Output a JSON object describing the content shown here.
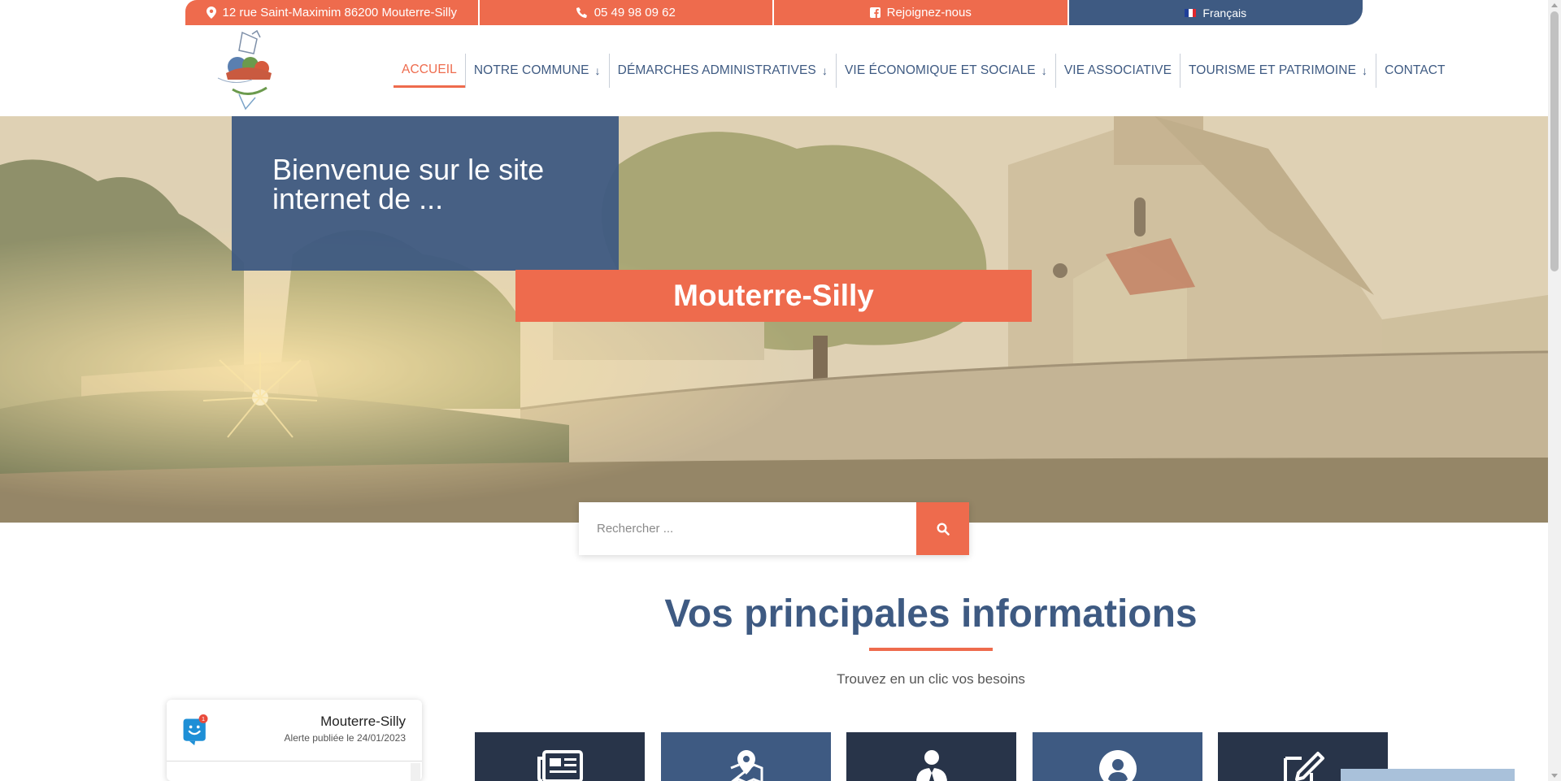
{
  "topbar": {
    "address": "12 rue Saint-Maximim 86200 Mouterre-Silly",
    "phone": "05 49 98 09 62",
    "social": "Rejoignez-nous",
    "language": "Français"
  },
  "logo": {
    "text": "Mouterre-Silly"
  },
  "nav": {
    "items": [
      {
        "label": "ACCUEIL"
      },
      {
        "label": "NOTRE COMMUNE"
      },
      {
        "label": "DÉMARCHES ADMINISTRATIVES"
      },
      {
        "label": "VIE ÉCONOMIQUE ET SOCIALE"
      },
      {
        "label": "VIE ASSOCIATIVE"
      },
      {
        "label": "TOURISME ET PATRIMOINE"
      },
      {
        "label": "CONTACT"
      }
    ]
  },
  "hero": {
    "welcome": "Bienvenue sur le site internet de ...",
    "town": "Mouterre-Silly"
  },
  "search": {
    "placeholder": "Rechercher ..."
  },
  "section": {
    "title": "Vos principales informations",
    "subtitle": "Trouvez en un clic vos besoins"
  },
  "tiles": [
    {
      "icon": "newspaper-icon"
    },
    {
      "icon": "map-pin-icon"
    },
    {
      "icon": "person-tie-icon"
    },
    {
      "icon": "user-circle-icon"
    },
    {
      "icon": "edit-icon"
    }
  ],
  "alert": {
    "title": "Mouterre-Silly",
    "date": "Alerte publiée le 24/01/2023",
    "badge": "1"
  },
  "colors": {
    "accent": "#ee6b4d",
    "primary": "#3e5a82",
    "dark": "#283449"
  }
}
